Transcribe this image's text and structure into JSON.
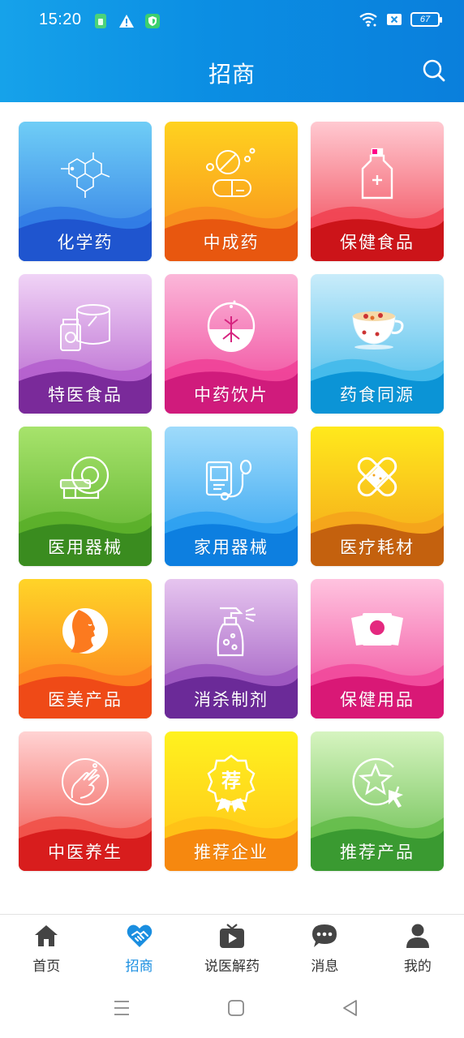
{
  "status_bar": {
    "time": "15:20",
    "battery": "67"
  },
  "header": {
    "title": "招商",
    "search_icon": "search-icon"
  },
  "categories": [
    {
      "label": "化学药",
      "icon": "chemical-structure-icon",
      "colors": [
        "#6fcdf6",
        "#2f79e4",
        "#1f55cf"
      ]
    },
    {
      "label": "中成药",
      "icon": "pill-capsule-icon",
      "colors": [
        "#ffd21f",
        "#f78b1e",
        "#e8570f"
      ]
    },
    {
      "label": "保健食品",
      "icon": "medicine-bottle-icon",
      "colors": [
        "#ffc9d1",
        "#f0404f",
        "#cc1419"
      ]
    },
    {
      "label": "特医食品",
      "icon": "formula-can-icon",
      "colors": [
        "#f0d3f6",
        "#b35dcc",
        "#7a2a9a"
      ]
    },
    {
      "label": "中药饮片",
      "icon": "herb-root-icon",
      "colors": [
        "#fbb7d9",
        "#ef3f97",
        "#d01b7c"
      ]
    },
    {
      "label": "药食同源",
      "icon": "herbal-tea-cup-icon",
      "colors": [
        "#c9ecfa",
        "#3fb8ea",
        "#0b94d6"
      ]
    },
    {
      "label": "医用器械",
      "icon": "ct-scanner-icon",
      "colors": [
        "#a7e36c",
        "#58ae28",
        "#3a8c1f"
      ]
    },
    {
      "label": "家用器械",
      "icon": "blood-pressure-monitor-icon",
      "colors": [
        "#9fdbfb",
        "#2a9ff0",
        "#0d7fe0"
      ]
    },
    {
      "label": "医疗耗材",
      "icon": "bandage-icon",
      "colors": [
        "#ffe91c",
        "#f4a21b",
        "#c4610e"
      ]
    },
    {
      "label": "医美产品",
      "icon": "beauty-face-icon",
      "colors": [
        "#ffd428",
        "#fb7a1e",
        "#ef4a17"
      ]
    },
    {
      "label": "消杀制剂",
      "icon": "spray-bottle-icon",
      "colors": [
        "#e6c5ef",
        "#9a52be",
        "#6b2a98"
      ]
    },
    {
      "label": "保健用品",
      "icon": "health-pack-icon",
      "colors": [
        "#ffc3df",
        "#f0479a",
        "#d91876"
      ]
    },
    {
      "label": "中医养生",
      "icon": "tcm-hand-icon",
      "colors": [
        "#ffd3d3",
        "#f04d45",
        "#d81d1d"
      ]
    },
    {
      "label": "推荐企业",
      "icon": "recommend-badge-icon",
      "colors": [
        "#fff21f",
        "#ffc018",
        "#f6880f"
      ]
    },
    {
      "label": "推荐产品",
      "icon": "star-cursor-icon",
      "colors": [
        "#d6f4c0",
        "#62bb48",
        "#3a9a31"
      ]
    }
  ],
  "badge_char": "荐",
  "tabbar": {
    "items": [
      {
        "label": "首页",
        "icon": "home-icon",
        "active": false
      },
      {
        "label": "招商",
        "icon": "handshake-heart-icon",
        "active": true
      },
      {
        "label": "说医解药",
        "icon": "video-play-icon",
        "active": false
      },
      {
        "label": "消息",
        "icon": "chat-bubble-icon",
        "active": false
      },
      {
        "label": "我的",
        "icon": "user-icon",
        "active": false
      }
    ],
    "active_color": "#1a8ee0"
  },
  "system_nav": {
    "buttons": [
      "menu-icon",
      "home-square-icon",
      "back-triangle-icon"
    ]
  }
}
